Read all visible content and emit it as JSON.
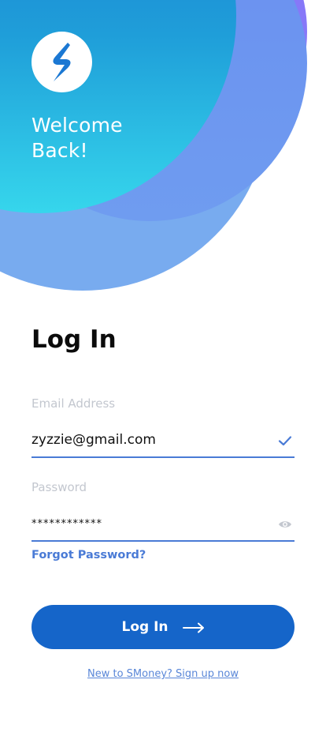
{
  "header": {
    "welcome_line1": "Welcome",
    "welcome_line2": "Back!"
  },
  "title": "Log In",
  "email": {
    "label": "Email Address",
    "value": "zyzzie@gmail.com"
  },
  "password": {
    "label": "Password",
    "value": "************"
  },
  "forgot_password": "Forgot Password?",
  "login_button": {
    "label": "Log In",
    "icon": "arrow-right-icon"
  },
  "signup_link": "New to SMoney? Sign up now",
  "icons": {
    "logo": "smoney-logo",
    "email_valid": "checkmark-icon",
    "password_toggle": "eye-icon"
  },
  "colors": {
    "primary": "#1565c9",
    "accent": "#4a7bd6",
    "link": "#5a87d8",
    "label": "#c3c7cf"
  }
}
